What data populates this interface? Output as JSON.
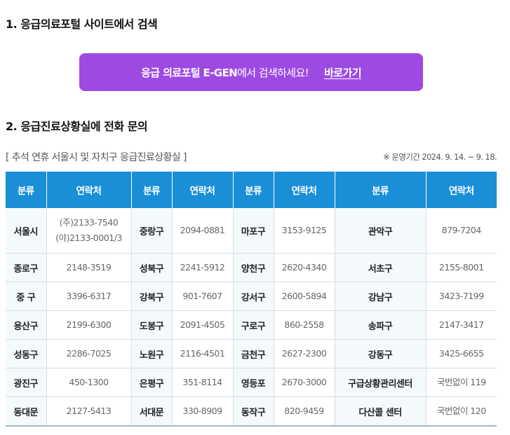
{
  "section1": {
    "title": "1. 응급의료포털 사이트에서 검색"
  },
  "banner": {
    "bold_text": "응급 의료포털 E-GEN",
    "text": "에서 검색하세요!",
    "link_label": "바로가기",
    "bg_color": "#9d4ae3"
  },
  "section2": {
    "title": "2. 응급진료상황실에 전화 문의"
  },
  "table_caption": "[ 추석 연휴 서울시 및 자치구 응급진료상황실 ]",
  "period": "※ 운영기간 2024. 9. 14. ~ 9. 18.",
  "table": {
    "header_color": "#1a8fd8",
    "headers": [
      "분류",
      "연락처",
      "분류",
      "연락처",
      "분류",
      "연락처",
      "분류",
      "연락처"
    ],
    "rows": [
      [
        {
          "cat": "서울시",
          "tel": [
            "(주)2133-7540",
            "(야)2133-0001/3"
          ]
        },
        {
          "cat": "중랑구",
          "tel": [
            "2094-0881"
          ]
        },
        {
          "cat": "마포구",
          "tel": [
            "3153-9125"
          ]
        },
        {
          "cat": "관악구",
          "tel": [
            "879-7204"
          ]
        }
      ],
      [
        {
          "cat": "종로구",
          "tel": [
            "2148-3519"
          ]
        },
        {
          "cat": "성북구",
          "tel": [
            "2241-5912"
          ]
        },
        {
          "cat": "양천구",
          "tel": [
            "2620-4340"
          ]
        },
        {
          "cat": "서초구",
          "tel": [
            "2155-8001"
          ]
        }
      ],
      [
        {
          "cat": "중 구",
          "tel": [
            "3396-6317"
          ]
        },
        {
          "cat": "강북구",
          "tel": [
            "901-7607"
          ]
        },
        {
          "cat": "강서구",
          "tel": [
            "2600-5894"
          ]
        },
        {
          "cat": "강남구",
          "tel": [
            "3423-7199"
          ]
        }
      ],
      [
        {
          "cat": "용산구",
          "tel": [
            "2199-6300"
          ]
        },
        {
          "cat": "도봉구",
          "tel": [
            "2091-4505"
          ]
        },
        {
          "cat": "구로구",
          "tel": [
            "860-2558"
          ]
        },
        {
          "cat": "송파구",
          "tel": [
            "2147-3417"
          ]
        }
      ],
      [
        {
          "cat": "성동구",
          "tel": [
            "2286-7025"
          ]
        },
        {
          "cat": "노원구",
          "tel": [
            "2116-4501"
          ]
        },
        {
          "cat": "금천구",
          "tel": [
            "2627-2300"
          ]
        },
        {
          "cat": "강동구",
          "tel": [
            "3425-6655"
          ]
        }
      ],
      [
        {
          "cat": "광진구",
          "tel": [
            "450-1300"
          ]
        },
        {
          "cat": "은평구",
          "tel": [
            "351-8114"
          ]
        },
        {
          "cat": "영등포",
          "tel": [
            "2670-3000"
          ]
        },
        {
          "cat": "구급상황관리센터",
          "tel": [
            "국번없이 119"
          ]
        }
      ],
      [
        {
          "cat": "동대문",
          "tel": [
            "2127-5413"
          ]
        },
        {
          "cat": "서대문",
          "tel": [
            "330-8909"
          ]
        },
        {
          "cat": "동작구",
          "tel": [
            "820-9459"
          ]
        },
        {
          "cat": "다산콜 센터",
          "tel": [
            "국번없이 120"
          ]
        }
      ]
    ]
  }
}
